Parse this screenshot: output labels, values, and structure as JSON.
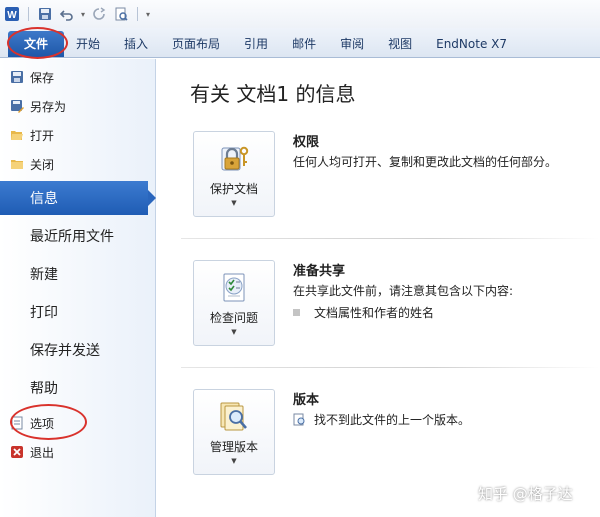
{
  "quick_access": {
    "icons": [
      "word-app-icon",
      "save-icon",
      "undo-icon",
      "redo-icon",
      "print-preview-icon",
      "customize-toolbar-icon"
    ]
  },
  "ribbon": {
    "tabs": [
      {
        "label": "文件"
      },
      {
        "label": "开始"
      },
      {
        "label": "插入"
      },
      {
        "label": "页面布局"
      },
      {
        "label": "引用"
      },
      {
        "label": "邮件"
      },
      {
        "label": "审阅"
      },
      {
        "label": "视图"
      },
      {
        "label": "EndNote X7"
      }
    ]
  },
  "nav": {
    "commands": [
      {
        "label": "保存",
        "icon": "save-icon"
      },
      {
        "label": "另存为",
        "icon": "save-as-icon"
      },
      {
        "label": "打开",
        "icon": "open-folder-icon"
      },
      {
        "label": "关闭",
        "icon": "close-folder-icon"
      }
    ],
    "tabs": [
      {
        "label": "信息",
        "active": true
      },
      {
        "label": "最近所用文件"
      },
      {
        "label": "新建"
      },
      {
        "label": "打印"
      },
      {
        "label": "保存并发送"
      },
      {
        "label": "帮助"
      }
    ],
    "bottom_commands": [
      {
        "label": "选项",
        "icon": "options-icon"
      },
      {
        "label": "退出",
        "icon": "exit-icon"
      }
    ]
  },
  "main": {
    "title": "有关 文档1 的信息",
    "sections": [
      {
        "button_label": "保护文档",
        "title": "权限",
        "description": "任何人均可打开、复制和更改此文档的任何部分。",
        "icon": "lock-key-icon"
      },
      {
        "button_label": "检查问题",
        "title": "准备共享",
        "description": "在共享此文件前，请注意其包含以下内容:",
        "items": [
          "文档属性和作者的姓名"
        ],
        "icon": "checklist-icon"
      },
      {
        "button_label": "管理版本",
        "title": "版本",
        "description": "找不到此文件的上一个版本。",
        "icon": "document-magnifier-icon"
      }
    ]
  },
  "watermark": "知乎 @格子达",
  "colors": {
    "file_tab": "#2a66bd",
    "active_nav": "#2a66bd",
    "annotation_red": "#d9322c"
  }
}
